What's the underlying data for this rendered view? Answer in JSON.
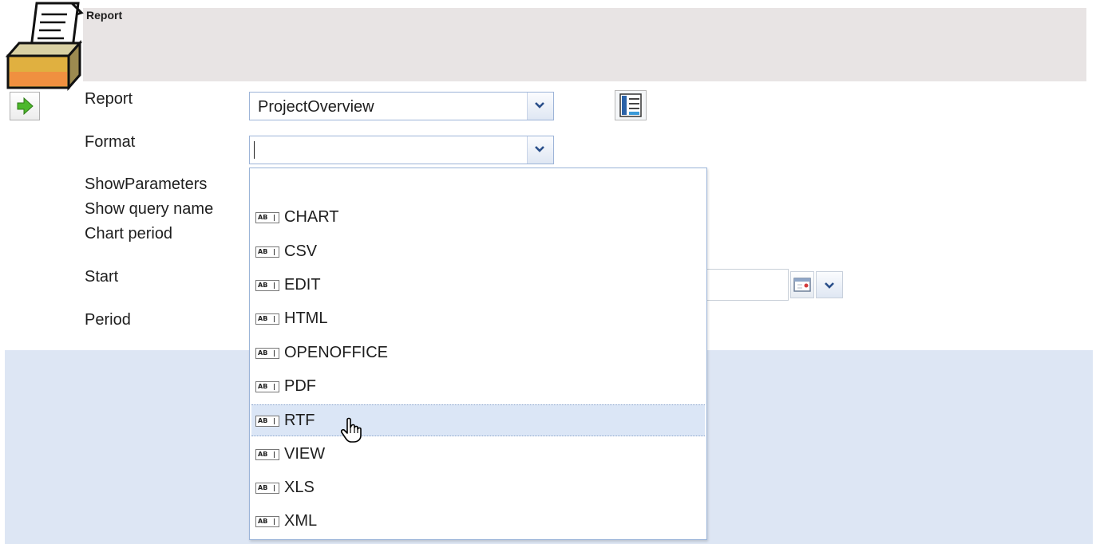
{
  "header": {
    "title": "Report",
    "icon": "report-printer-icon"
  },
  "form": {
    "report_label": "Report",
    "report_value": "ProjectOverview",
    "format_label": "Format",
    "format_value": "",
    "show_parameters_label": "ShowParameters",
    "show_query_name_label": "Show query name",
    "chart_period_label": "Chart period",
    "start_label": "Start",
    "period_label": "Period"
  },
  "format_options": [
    "",
    "CHART",
    "CSV",
    "EDIT",
    "HTML",
    "OPENOFFICE",
    "PDF",
    "RTF",
    "VIEW",
    "XLS",
    "XML"
  ],
  "highlighted_option": "RTF",
  "option_icon_text": "AB",
  "colors": {
    "header_band": "#e8e4e4",
    "blue_region": "#dde6f4",
    "highlight": "#dbe6f6",
    "run_arrow": "#4db82c"
  }
}
